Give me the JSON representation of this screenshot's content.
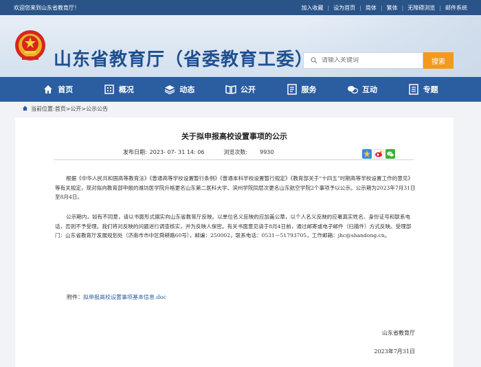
{
  "topbar": {
    "welcome": "欢迎您来到山东省教育厅！",
    "links": [
      "加入收藏",
      "设为首页",
      "简体",
      "繁体",
      "无障碍浏览",
      "邮件系统"
    ]
  },
  "header": {
    "title": "山东省教育厅（省委教育工委）",
    "search_placeholder": "请输入关键词",
    "search_button": "搜索"
  },
  "nav": {
    "items": [
      {
        "label": "首页",
        "icon": "home-icon"
      },
      {
        "label": "概况",
        "icon": "building-icon"
      },
      {
        "label": "动态",
        "icon": "layers-icon"
      },
      {
        "label": "公开",
        "icon": "book-icon"
      },
      {
        "label": "服务",
        "icon": "document-icon"
      },
      {
        "label": "互动",
        "icon": "chat-icon"
      },
      {
        "label": "专题",
        "icon": "list-icon"
      }
    ]
  },
  "breadcrumb": {
    "prefix": "当前位置:",
    "home": "首页",
    "sep1": ">",
    "level1": "公开",
    "sep2": ">",
    "level2": "公示公告"
  },
  "article": {
    "title": "关于拟申报高校设置事项的公示",
    "publish_label": "发布日期:",
    "publish_date": "2023- 07- 31 14: 06",
    "views_label": "浏览次数:",
    "views": "9930",
    "para1": "根据《中华人民共和国高等教育法》《普通高等学校设置暂行条例》《普通本科学校设置暂行规定》《教育部关于“十四五”时期高等学校设置工作的意见》等有关规定，现对拟向教育部申报的潍坊医学院升格更名山东第二医科大学、滨州学院同层次更名山东航空学院2个事项予以公示。公示期为2023年7月31日至8月4日。",
    "para2": "公示期内，如有不同意，请以书面形式据实向山东省教育厅反映。以单位名义反映的应加盖公章，以个人名义反映的应署真实姓名、身份证号和联系电话，否则不予受理。我们将对反映的问题进行调查核实，并为反映人保密。有关书面意见请于8月4日前，通过邮寄或电子邮件（扫描件）方式反映。受理部门：山东省教育厅发展规划处（济南市市中区舜耕路60号），邮编：250002，联系电话：0531－51793705，工作邮箱：jhc@shandong.cn。",
    "attachment_label": "附件：",
    "attachment_link": "拟申报高校设置事项基本信息.doc",
    "signature": "山东省教育厅",
    "sign_date": "2023年7月31日"
  },
  "colors": {
    "topbar": "#2a5387",
    "nav": "#2b5da1",
    "title": "#1f4f8f",
    "search_button": "#f39a1c"
  }
}
